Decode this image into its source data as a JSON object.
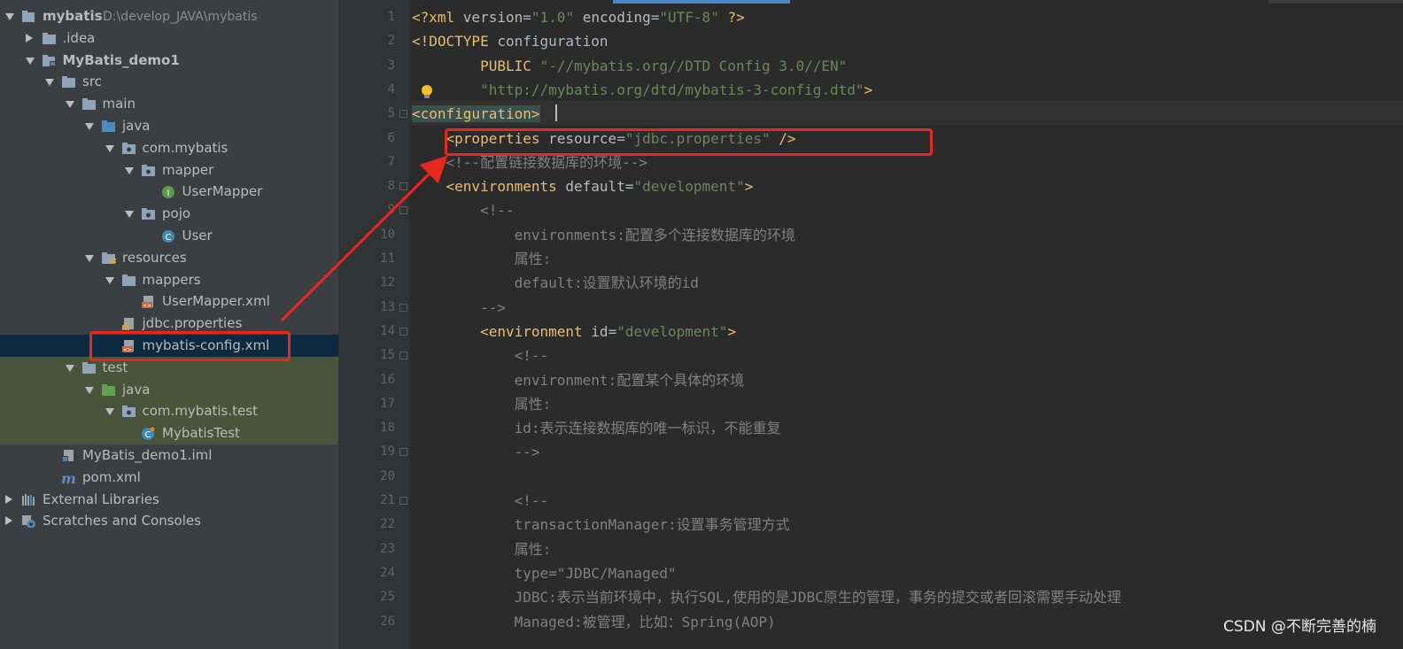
{
  "project_tree": {
    "items": [
      {
        "label": "mybatis",
        "path": "D:\\develop_JAVA\\mybatis",
        "icon": "project-folder-icon",
        "expanded": true,
        "bold": true
      },
      {
        "label": ".idea",
        "icon": "folder-icon",
        "expanded": false
      },
      {
        "label": "MyBatis_demo1",
        "icon": "module-folder-icon",
        "expanded": true,
        "bold": true
      },
      {
        "label": "src",
        "icon": "folder-icon",
        "expanded": true
      },
      {
        "label": "main",
        "icon": "folder-icon",
        "expanded": true
      },
      {
        "label": "java",
        "icon": "source-root-icon",
        "expanded": true
      },
      {
        "label": "com.mybatis",
        "icon": "package-icon",
        "expanded": true
      },
      {
        "label": "mapper",
        "icon": "package-icon",
        "expanded": true
      },
      {
        "label": "UserMapper",
        "icon": "interface-icon"
      },
      {
        "label": "pojo",
        "icon": "package-icon",
        "expanded": true
      },
      {
        "label": "User",
        "icon": "class-icon"
      },
      {
        "label": "resources",
        "icon": "resources-folder-icon",
        "expanded": true
      },
      {
        "label": "mappers",
        "icon": "folder-icon",
        "expanded": true
      },
      {
        "label": "UserMapper.xml",
        "icon": "xml-file-icon"
      },
      {
        "label": "jdbc.properties",
        "icon": "properties-file-icon"
      },
      {
        "label": "mybatis-config.xml",
        "icon": "xml-file-icon",
        "selected": true
      },
      {
        "label": "test",
        "icon": "folder-icon",
        "expanded": true
      },
      {
        "label": "java",
        "icon": "test-source-root-icon",
        "expanded": true
      },
      {
        "label": "com.mybatis.test",
        "icon": "package-icon",
        "expanded": true
      },
      {
        "label": "MybatisTest",
        "icon": "test-class-icon"
      },
      {
        "label": "MyBatis_demo1.iml",
        "icon": "iml-file-icon"
      },
      {
        "label": "pom.xml",
        "icon": "maven-icon"
      },
      {
        "label": "External Libraries",
        "icon": "libraries-icon",
        "expanded": false
      },
      {
        "label": "Scratches and Consoles",
        "icon": "scratches-icon",
        "expanded": false
      }
    ]
  },
  "editor": {
    "lines": [
      {
        "n": "1",
        "segs": [
          [
            "tg",
            "<?xml "
          ],
          [
            "at",
            "version"
          ],
          [
            "pl",
            "="
          ],
          [
            "av",
            "\"1.0\""
          ],
          [
            "pl",
            " "
          ],
          [
            "at",
            "encoding"
          ],
          [
            "pl",
            "="
          ],
          [
            "av",
            "\"UTF-8\""
          ],
          [
            "pl",
            " "
          ],
          [
            "tg",
            "?>"
          ]
        ]
      },
      {
        "n": "2",
        "segs": [
          [
            "tg",
            "<!DOCTYPE "
          ],
          [
            "pl",
            "configuration"
          ]
        ]
      },
      {
        "n": "3",
        "segs": [
          [
            "pl",
            "        "
          ],
          [
            "tg",
            "PUBLIC "
          ],
          [
            "av",
            "\"-//mybatis.org//DTD Config 3.0//EN\""
          ]
        ]
      },
      {
        "n": "4",
        "segs": [
          [
            "pl",
            "        "
          ],
          [
            "av",
            "\"http://mybatis.org/dtd/mybatis-3-config.dtd\""
          ],
          [
            "tg",
            ">"
          ]
        ]
      },
      {
        "n": "5",
        "segs": [
          [
            "tg",
            "<configuration>"
          ]
        ],
        "caret": true
      },
      {
        "n": "6",
        "segs": [
          [
            "pl",
            "    "
          ],
          [
            "tg",
            "<properties "
          ],
          [
            "at",
            "resource"
          ],
          [
            "pl",
            "="
          ],
          [
            "av",
            "\"jdbc.properties\""
          ],
          [
            "pl",
            " "
          ],
          [
            "tg",
            "/>"
          ]
        ]
      },
      {
        "n": "7",
        "segs": [
          [
            "pl",
            "    "
          ],
          [
            "cm",
            "<!--配置链接数据库的环境-->"
          ]
        ]
      },
      {
        "n": "8",
        "segs": [
          [
            "pl",
            "    "
          ],
          [
            "tg",
            "<environments "
          ],
          [
            "at",
            "default"
          ],
          [
            "pl",
            "="
          ],
          [
            "av",
            "\"development\""
          ],
          [
            "tg",
            ">"
          ]
        ]
      },
      {
        "n": "9",
        "segs": [
          [
            "pl",
            "        "
          ],
          [
            "cm",
            "<!--"
          ]
        ]
      },
      {
        "n": "10",
        "segs": [
          [
            "pl",
            "            "
          ],
          [
            "cm",
            "environments:配置多个连接数据库的环境"
          ]
        ]
      },
      {
        "n": "11",
        "segs": [
          [
            "pl",
            "            "
          ],
          [
            "cm",
            "属性:"
          ]
        ]
      },
      {
        "n": "12",
        "segs": [
          [
            "pl",
            "            "
          ],
          [
            "cm",
            "default:设置默认环境的id"
          ]
        ]
      },
      {
        "n": "13",
        "segs": [
          [
            "pl",
            "        "
          ],
          [
            "cm",
            "-->"
          ]
        ]
      },
      {
        "n": "14",
        "segs": [
          [
            "pl",
            "        "
          ],
          [
            "tg",
            "<environment "
          ],
          [
            "at",
            "id"
          ],
          [
            "pl",
            "="
          ],
          [
            "av",
            "\"development\""
          ],
          [
            "tg",
            ">"
          ]
        ]
      },
      {
        "n": "15",
        "segs": [
          [
            "pl",
            "            "
          ],
          [
            "cm",
            "<!--"
          ]
        ]
      },
      {
        "n": "16",
        "segs": [
          [
            "pl",
            "            "
          ],
          [
            "cm",
            "environment:配置某个具体的环境"
          ]
        ]
      },
      {
        "n": "17",
        "segs": [
          [
            "pl",
            "            "
          ],
          [
            "cm",
            "属性:"
          ]
        ]
      },
      {
        "n": "18",
        "segs": [
          [
            "pl",
            "            "
          ],
          [
            "cm",
            "id:表示连接数据库的唯一标识，不能重复"
          ]
        ]
      },
      {
        "n": "19",
        "segs": [
          [
            "pl",
            "            "
          ],
          [
            "cm",
            "-->"
          ]
        ]
      },
      {
        "n": "20",
        "segs": []
      },
      {
        "n": "21",
        "segs": [
          [
            "pl",
            "            "
          ],
          [
            "cm",
            "<!--"
          ]
        ]
      },
      {
        "n": "22",
        "segs": [
          [
            "pl",
            "            "
          ],
          [
            "cm",
            "transactionManager:设置事务管理方式"
          ]
        ]
      },
      {
        "n": "23",
        "segs": [
          [
            "pl",
            "            "
          ],
          [
            "cm",
            "属性:"
          ]
        ]
      },
      {
        "n": "24",
        "segs": [
          [
            "pl",
            "            "
          ],
          [
            "cm",
            "type=\"JDBC/Managed\""
          ]
        ]
      },
      {
        "n": "25",
        "segs": [
          [
            "pl",
            "            "
          ],
          [
            "cm",
            "JDBC:表示当前环境中，执行SQL,使用的是JDBC原生的管理，事务的提交或者回滚需要手动处理"
          ]
        ]
      },
      {
        "n": "26",
        "segs": [
          [
            "pl",
            "            "
          ],
          [
            "cm",
            "Managed:被管理，比如：Spring(AOP)"
          ]
        ]
      }
    ]
  },
  "colors": {
    "tag": "#e8bf6a",
    "attr": "#bababa",
    "value": "#6a8759",
    "comment": "#808080",
    "annotation": "#e8281e",
    "selection": "#0d293e"
  },
  "watermark": "CSDN @不断完善的楠"
}
